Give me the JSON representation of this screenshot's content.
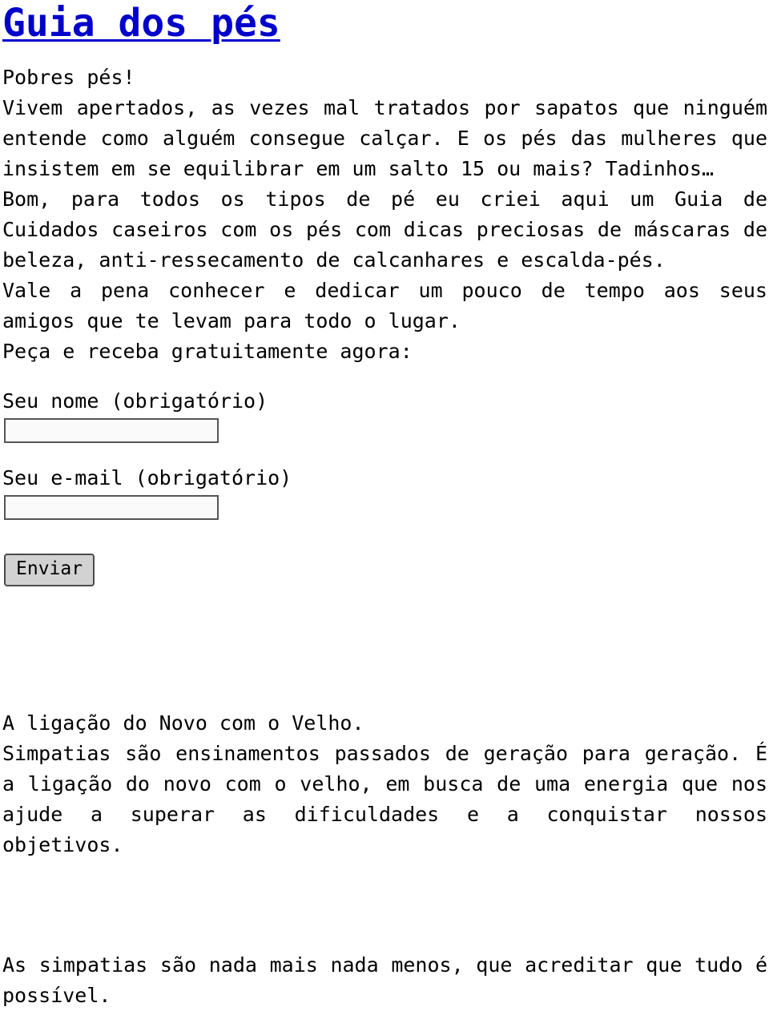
{
  "header": {
    "title": "Guia dos pés",
    "title_color": "#0000cc"
  },
  "intro": {
    "lines": [
      "Pobres pés!",
      "Vivem apertados, as vezes mal tratados por sapatos que ninguém entende como alguém consegue calçar. E os pés das mulheres que insistem em se equilibrar em um salto 15 ou mais? Tadinhos…",
      "Bom, para todos os tipos de pé eu criei aqui um Guia de Cuidados caseiros com os pés com dicas preciosas de máscaras de beleza, anti-ressecamento de calcanhares e escalda-pés.",
      "Vale a pena conhecer e dedicar um pouco de tempo aos seus amigos que te levam para todo o lugar.",
      "Peça e receba gratuitamente agora:"
    ]
  },
  "form": {
    "name_label": "Seu nome (obrigatório)",
    "name_value": "",
    "name_placeholder": "",
    "email_label": "Seu e-mail (obrigatório)",
    "email_value": "",
    "email_placeholder": "",
    "submit_label": "Enviar"
  },
  "article": {
    "heading": "A ligação do Novo com o Velho.",
    "body": "Simpatias são ensinamentos passados de geração para geração. É a ligação do novo com o velho, em busca de uma energia que nos ajude a superar as dificuldades e a conquistar nossos objetivos."
  },
  "footer_note": {
    "text": "As simpatias são nada mais nada menos, que acreditar que tudo é possível."
  }
}
